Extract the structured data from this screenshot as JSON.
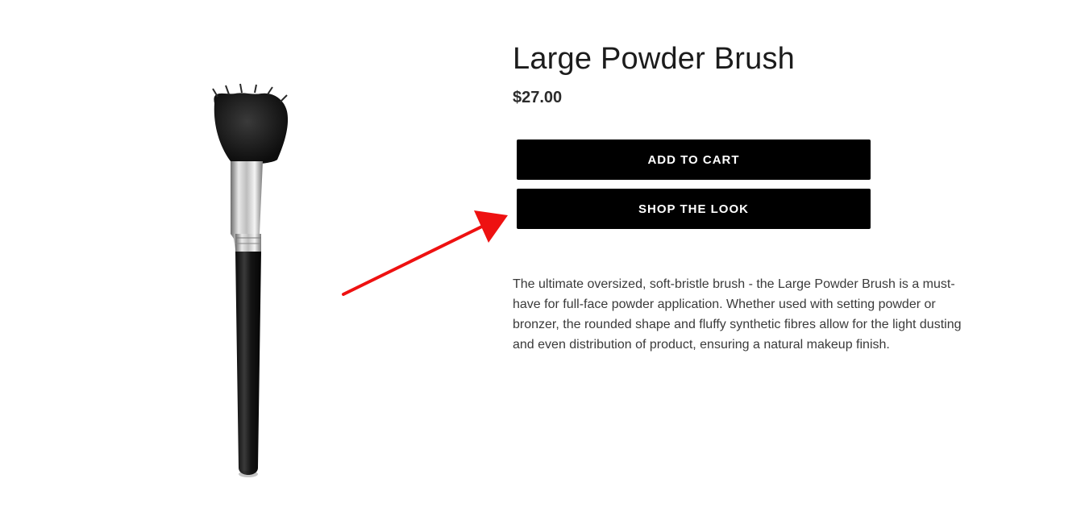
{
  "product": {
    "title": "Large Powder Brush",
    "price": "$27.00",
    "description": "The ultimate oversized, soft-bristle brush - the Large Powder Brush is a must-have for full-face powder application. Whether used with setting powder or bronzer, the rounded shape and fluffy synthetic fibres allow for the light dusting and even distribution of product, ensuring a natural makeup finish."
  },
  "actions": {
    "add_to_cart_label": "ADD TO CART",
    "shop_the_look_label": "SHOP THE LOOK"
  },
  "annotation": {
    "icon": "arrow-icon",
    "color": "#ee1111"
  },
  "colors": {
    "button_background": "#000000",
    "button_text": "#ffffff",
    "title_text": "#1c1c1c",
    "body_text": "#3a3a3a"
  }
}
